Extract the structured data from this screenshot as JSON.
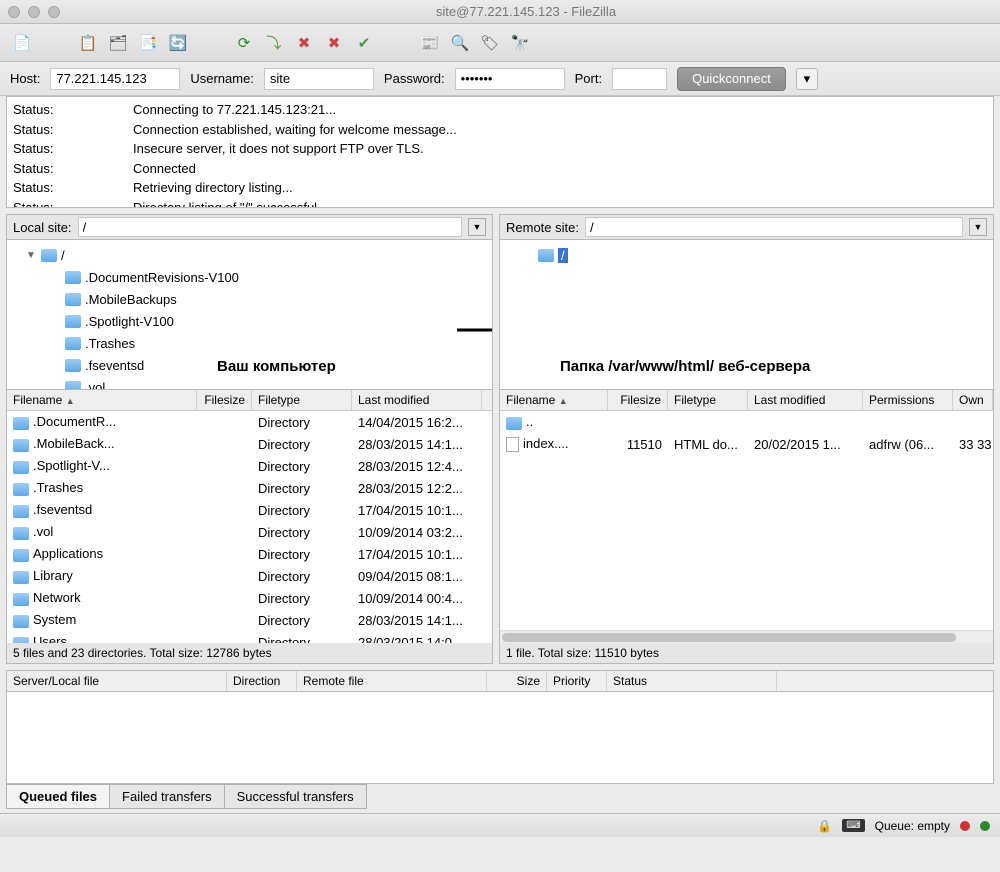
{
  "window": {
    "title": "site@77.221.145.123 - FileZilla"
  },
  "connect": {
    "host_label": "Host:",
    "host": "77.221.145.123",
    "user_label": "Username:",
    "user": "site",
    "pass_label": "Password:",
    "pass": "•••••••",
    "port_label": "Port:",
    "port": "",
    "quick": "Quickconnect"
  },
  "log": [
    {
      "k": "Status:",
      "v": "Connecting to 77.221.145.123:21..."
    },
    {
      "k": "Status:",
      "v": "Connection established, waiting for welcome message..."
    },
    {
      "k": "Status:",
      "v": "Insecure server, it does not support FTP over TLS."
    },
    {
      "k": "Status:",
      "v": "Connected"
    },
    {
      "k": "Status:",
      "v": "Retrieving directory listing..."
    },
    {
      "k": "Status:",
      "v": "Directory listing of \"/\" successful"
    }
  ],
  "local": {
    "label": "Local site:",
    "path": "/",
    "tree": [
      "/",
      ".DocumentRevisions-V100",
      ".MobileBackups",
      ".Spotlight-V100",
      ".Trashes",
      ".fseventsd",
      ".vol"
    ],
    "cols": {
      "name": "Filename",
      "size": "Filesize",
      "type": "Filetype",
      "mod": "Last modified"
    },
    "files": [
      {
        "n": ".DocumentR...",
        "t": "Directory",
        "m": "14/04/2015 16:2..."
      },
      {
        "n": ".MobileBack...",
        "t": "Directory",
        "m": "28/03/2015 14:1..."
      },
      {
        "n": ".Spotlight-V...",
        "t": "Directory",
        "m": "28/03/2015 12:4..."
      },
      {
        "n": ".Trashes",
        "t": "Directory",
        "m": "28/03/2015 12:2..."
      },
      {
        "n": ".fseventsd",
        "t": "Directory",
        "m": "17/04/2015 10:1..."
      },
      {
        "n": ".vol",
        "t": "Directory",
        "m": "10/09/2014 03:2..."
      },
      {
        "n": "Applications",
        "t": "Directory",
        "m": "17/04/2015 10:1..."
      },
      {
        "n": "Library",
        "t": "Directory",
        "m": "09/04/2015 08:1..."
      },
      {
        "n": "Network",
        "t": "Directory",
        "m": "10/09/2014 00:4..."
      },
      {
        "n": "System",
        "t": "Directory",
        "m": "28/03/2015 14:1..."
      },
      {
        "n": "Users",
        "t": "Directory",
        "m": "28/03/2015 14:0..."
      }
    ],
    "status": "5 files and 23 directories. Total size: 12786 bytes",
    "annotation": "Ваш компьютер"
  },
  "remote": {
    "label": "Remote site:",
    "path": "/",
    "tree": [
      "/"
    ],
    "cols": {
      "name": "Filename",
      "size": "Filesize",
      "type": "Filetype",
      "mod": "Last modified",
      "perm": "Permissions",
      "own": "Own"
    },
    "files": [
      {
        "n": "..",
        "s": "",
        "t": "",
        "m": "",
        "p": "",
        "o": "",
        "icon": "folder"
      },
      {
        "n": "index....",
        "s": "11510",
        "t": "HTML do...",
        "m": "20/02/2015 1...",
        "p": "adfrw (06...",
        "o": "33 33",
        "icon": "file"
      }
    ],
    "status": "1 file. Total size: 11510 bytes",
    "annotation": "Папка /var/www/html/ веб-сервера"
  },
  "transfer": {
    "cols": {
      "srv": "Server/Local file",
      "dir": "Direction",
      "rem": "Remote file",
      "size": "Size",
      "pri": "Priority",
      "stat": "Status"
    }
  },
  "tabs": {
    "queued": "Queued files",
    "failed": "Failed transfers",
    "success": "Successful transfers"
  },
  "footer": {
    "queue": "Queue: empty"
  }
}
